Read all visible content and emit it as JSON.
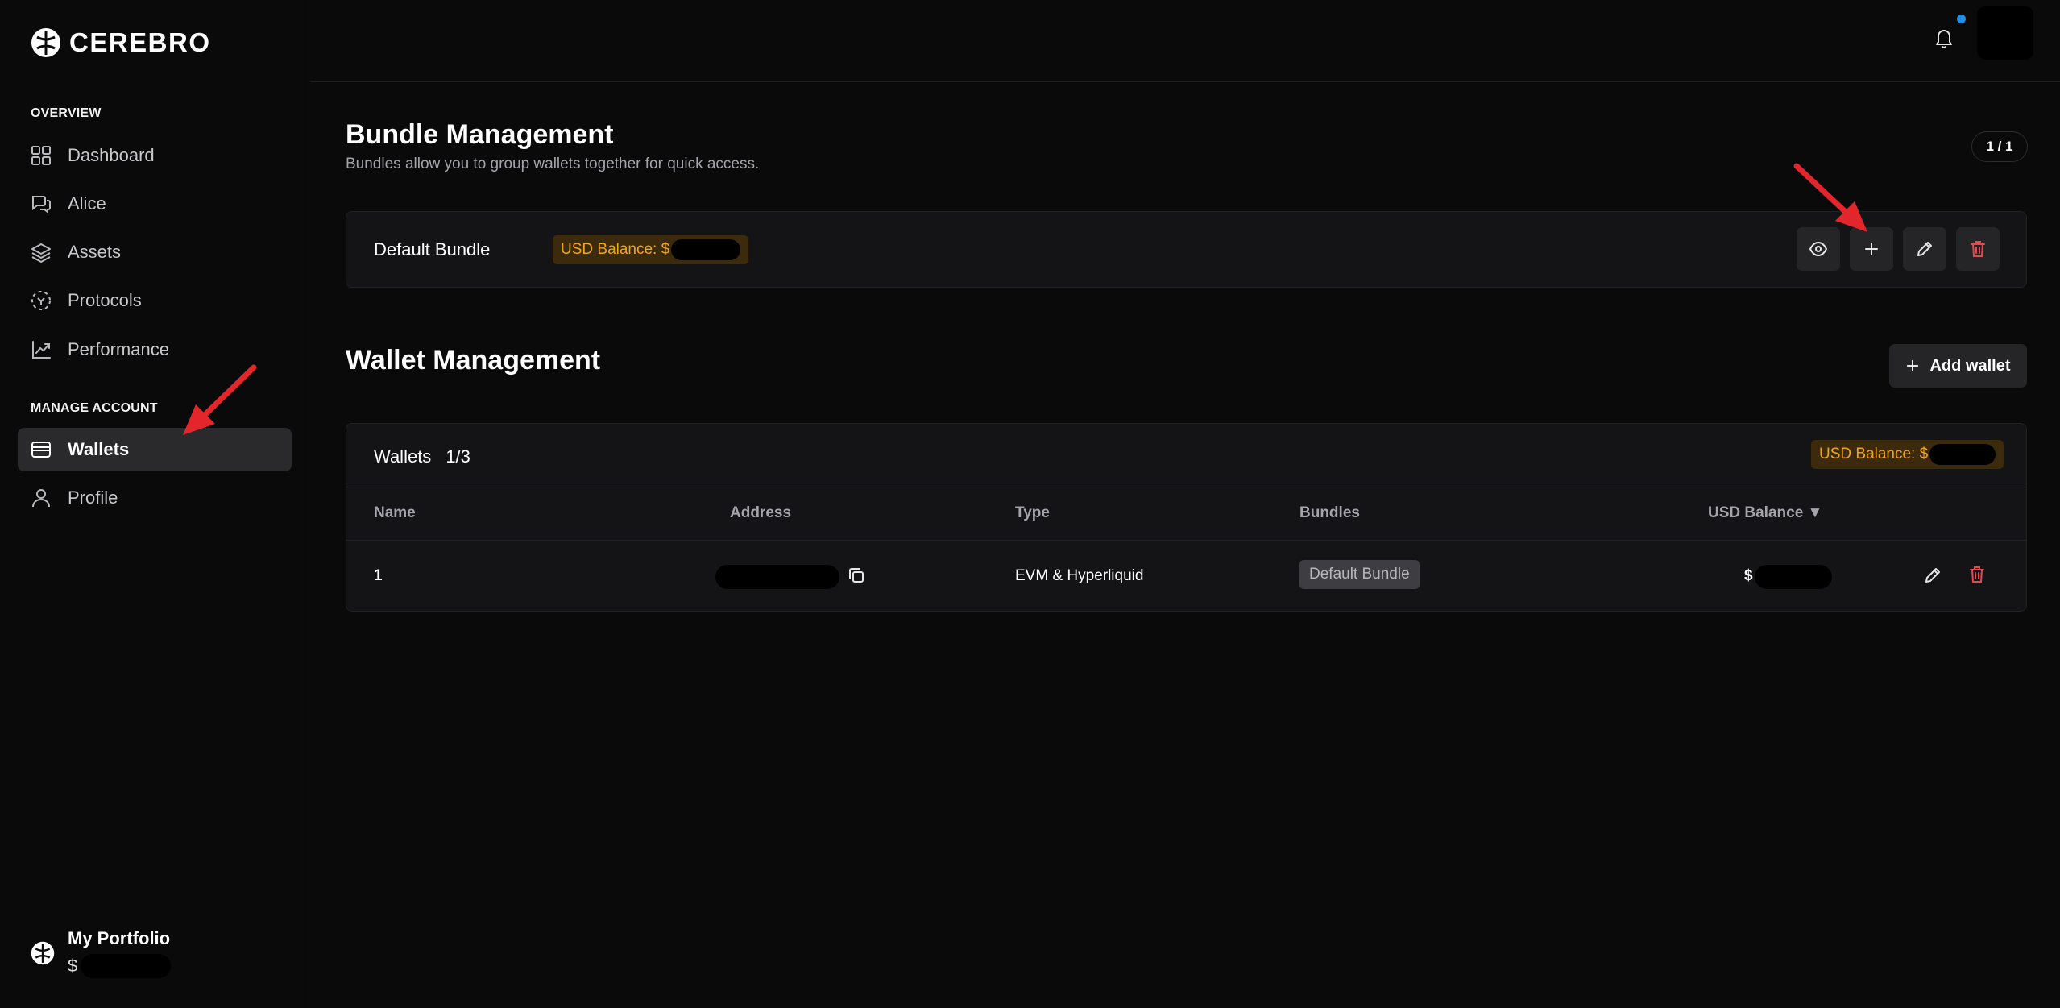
{
  "brand": {
    "name": "CEREBRO"
  },
  "sidebar": {
    "sections": [
      {
        "label": "OVERVIEW"
      },
      {
        "label": "MANAGE ACCOUNT"
      }
    ],
    "items": [
      {
        "label": "Dashboard",
        "icon": "dashboard-grid-icon"
      },
      {
        "label": "Alice",
        "icon": "chat-icon"
      },
      {
        "label": "Assets",
        "icon": "layers-icon"
      },
      {
        "label": "Protocols",
        "icon": "protocols-icon"
      },
      {
        "label": "Performance",
        "icon": "chart-line-icon"
      },
      {
        "label": "Wallets",
        "icon": "wallet-icon",
        "active": true
      },
      {
        "label": "Profile",
        "icon": "user-icon"
      }
    ],
    "portfolio": {
      "title": "My Portfolio",
      "currency": "$"
    }
  },
  "bundle_management": {
    "title": "Bundle Management",
    "subtitle": "Bundles allow you to group wallets together for quick access.",
    "pager": "1 / 1",
    "bundle": {
      "name": "Default Bundle",
      "balance_label": "USD Balance: $"
    }
  },
  "wallet_management": {
    "title": "Wallet Management",
    "add_wallet_label": "Add wallet",
    "card_title": "Wallets",
    "count": "1/3",
    "balance_label": "USD Balance: $",
    "columns": [
      "Name",
      "Address",
      "Type",
      "Bundles",
      "USD Balance ▼"
    ],
    "rows": [
      {
        "name": "1",
        "type": "EVM & Hyperliquid",
        "bundle": "Default Bundle",
        "currency": "$"
      }
    ]
  },
  "colors": {
    "accent_gold": "#f2a516",
    "danger": "#e5484d",
    "notification": "#1d8fe6"
  }
}
